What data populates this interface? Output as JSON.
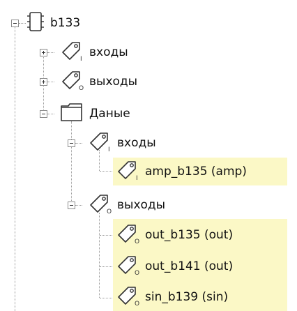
{
  "tree": {
    "root": {
      "label": "b133",
      "icon": "chip-icon"
    },
    "inputs": {
      "label": "входы",
      "icon": "tag-icon-input"
    },
    "outputs": {
      "label": "выходы",
      "icon": "tag-icon-output"
    },
    "data": {
      "label": "Даные",
      "icon": "folder-icon",
      "inputs": {
        "label": "входы",
        "icon": "tag-icon-input",
        "items": [
          {
            "label": "amp_b135 (amp)",
            "icon": "tag-icon-input"
          }
        ]
      },
      "outputs": {
        "label": "выходы",
        "icon": "tag-icon-output",
        "items": [
          {
            "label": "out_b135 (out)",
            "icon": "tag-icon-output"
          },
          {
            "label": "out_b141 (out)",
            "icon": "tag-icon-output"
          },
          {
            "label": "sin_b139 (sin)",
            "icon": "tag-icon-output"
          }
        ]
      }
    }
  },
  "colors": {
    "highlight": "#fbf8c6",
    "line": "#9a9a9a"
  }
}
